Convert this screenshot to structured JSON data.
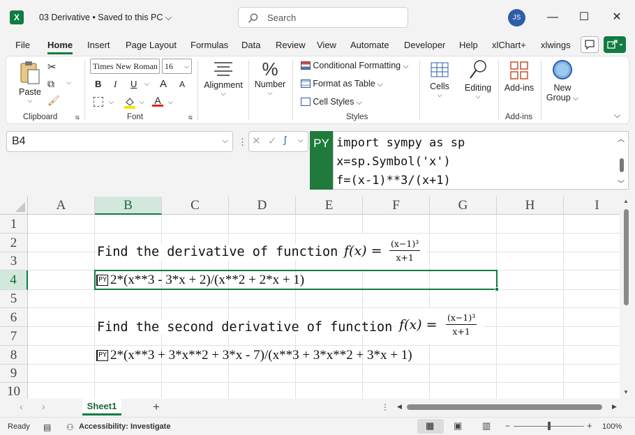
{
  "app": {
    "title": "03 Derivative",
    "save_status": "Saved to this PC",
    "search_placeholder": "Search",
    "user_initials": "JS"
  },
  "menu": [
    "File",
    "Home",
    "Insert",
    "Page Layout",
    "Formulas",
    "Data",
    "Review",
    "View",
    "Automate",
    "Developer",
    "Help",
    "xlChart+",
    "xlwings"
  ],
  "ribbon": {
    "clipboard": {
      "paste": "Paste",
      "label": "Clipboard"
    },
    "font": {
      "family": "Times New Roman",
      "size": "16",
      "label": "Font",
      "bold": "B",
      "italic": "I",
      "underline": "U",
      "grow": "A",
      "shrink": "A"
    },
    "alignment": {
      "label": "Alignment"
    },
    "number": {
      "label": "Number"
    },
    "styles": {
      "conditional": "Conditional Formatting",
      "table": "Format as Table",
      "cell_styles": "Cell Styles",
      "label": "Styles"
    },
    "cells": {
      "label": "Cells"
    },
    "editing": {
      "label": "Editing"
    },
    "addins": {
      "label": "Add-ins",
      "group_label": "Add-ins"
    },
    "newgroup": {
      "label1": "New",
      "label2": "Group"
    }
  },
  "formula_bar": {
    "name_box": "B4",
    "py_badge": "PY",
    "lines": [
      "import sympy as sp",
      "x=sp.Symbol('x')",
      "f=(x-1)**3/(x+1)"
    ]
  },
  "grid": {
    "columns": [
      "A",
      "B",
      "C",
      "D",
      "E",
      "F",
      "G",
      "H",
      "I"
    ],
    "rows": [
      "1",
      "2",
      "3",
      "4",
      "5",
      "6",
      "7",
      "8",
      "9",
      "10"
    ],
    "selected_col": "B",
    "selected_row": "4",
    "b2_text": "Find the derivative of function",
    "b6_text": "Find the second derivative of function",
    "func_lhs": "f(x) =",
    "func_num": "(x−1)³",
    "func_den": "x+1",
    "py_tag": "PY",
    "b4_value": "2*(x**3 - 3*x + 2)/(x**2 + 2*x + 1)",
    "b8_value": "2*(x**3 + 3*x**2 + 3*x - 7)/(x**3 + 3*x**2 + 3*x + 1)"
  },
  "sheets": {
    "active": "Sheet1"
  },
  "status": {
    "ready": "Ready",
    "accessibility": "Accessibility: Investigate",
    "zoom": "100%"
  }
}
